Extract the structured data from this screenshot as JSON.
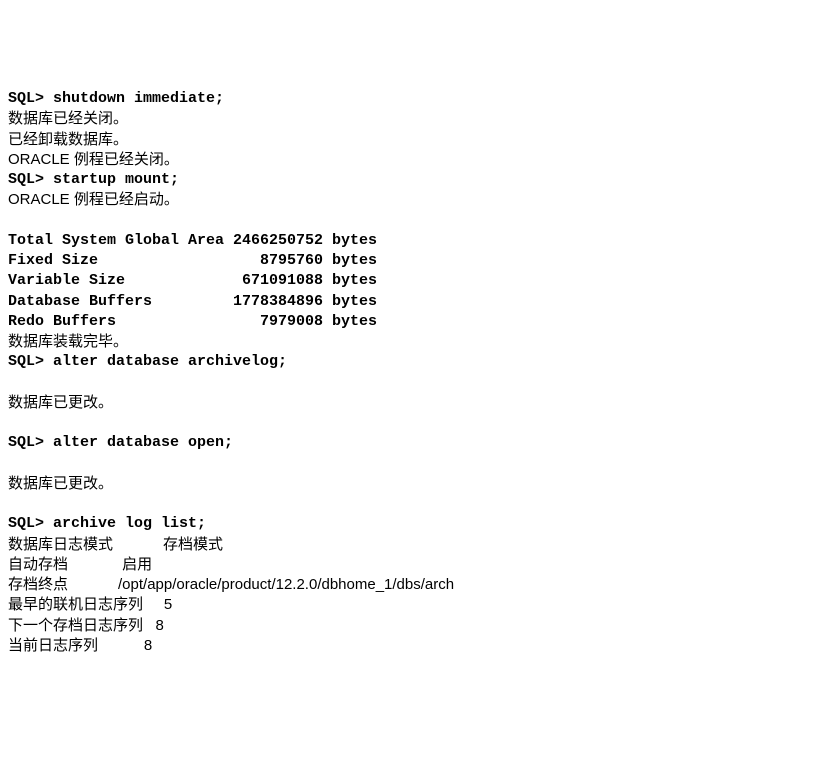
{
  "lines": [
    {
      "text": "SQL> shutdown immediate;",
      "bold": true,
      "cjk": false
    },
    {
      "text": "数据库已经关闭。",
      "bold": false,
      "cjk": true
    },
    {
      "text": "已经卸载数据库。",
      "bold": false,
      "cjk": true
    },
    {
      "text": "ORACLE 例程已经关闭。",
      "bold": false,
      "cjk": true
    },
    {
      "text": "SQL> startup mount;",
      "bold": true,
      "cjk": false
    },
    {
      "text": "ORACLE 例程已经启动。",
      "bold": false,
      "cjk": true
    },
    {
      "text": "",
      "bold": false,
      "cjk": false
    },
    {
      "text": "Total System Global Area 2466250752 bytes",
      "bold": true,
      "cjk": false
    },
    {
      "text": "Fixed Size                  8795760 bytes",
      "bold": true,
      "cjk": false
    },
    {
      "text": "Variable Size             671091088 bytes",
      "bold": true,
      "cjk": false
    },
    {
      "text": "Database Buffers         1778384896 bytes",
      "bold": true,
      "cjk": false
    },
    {
      "text": "Redo Buffers                7979008 bytes",
      "bold": true,
      "cjk": false
    },
    {
      "text": "数据库装载完毕。",
      "bold": false,
      "cjk": true
    },
    {
      "text": "SQL> alter database archivelog;",
      "bold": true,
      "cjk": false
    },
    {
      "text": "",
      "bold": false,
      "cjk": false
    },
    {
      "text": "数据库已更改。",
      "bold": false,
      "cjk": true
    },
    {
      "text": "",
      "bold": false,
      "cjk": false
    },
    {
      "text": "SQL> alter database open;",
      "bold": true,
      "cjk": false
    },
    {
      "text": "",
      "bold": false,
      "cjk": false
    },
    {
      "text": "数据库已更改。",
      "bold": false,
      "cjk": true
    },
    {
      "text": "",
      "bold": false,
      "cjk": false
    },
    {
      "text": "SQL> archive log list;",
      "bold": true,
      "cjk": false
    },
    {
      "text": "数据库日志模式            存档模式",
      "bold": false,
      "cjk": true
    },
    {
      "text": "自动存档             启用",
      "bold": false,
      "cjk": true
    },
    {
      "text": "存档终点            /opt/app/oracle/product/12.2.0/dbhome_1/dbs/arch",
      "bold": false,
      "cjk": true
    },
    {
      "text": "最早的联机日志序列     5",
      "bold": false,
      "cjk": true
    },
    {
      "text": "下一个存档日志序列   8",
      "bold": false,
      "cjk": true
    },
    {
      "text": "当前日志序列           8",
      "bold": false,
      "cjk": true
    }
  ]
}
